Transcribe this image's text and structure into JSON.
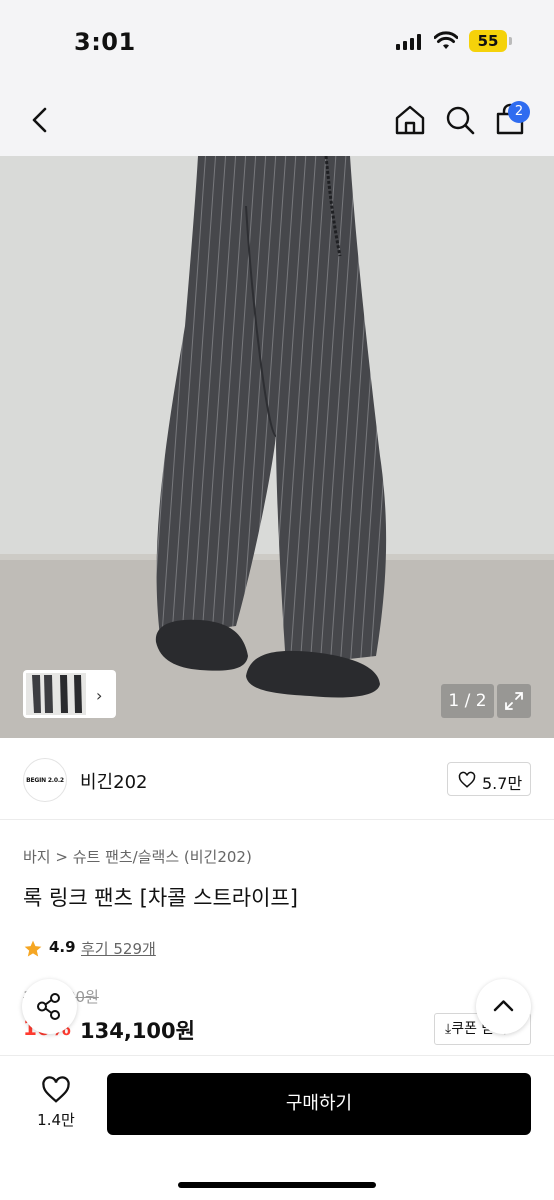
{
  "status_bar": {
    "time": "3:01",
    "battery": "55"
  },
  "nav": {
    "cart_count": "2"
  },
  "gallery": {
    "page_indicator": "1 / 2"
  },
  "brand": {
    "logo_text": "BEGIN 2.0.2",
    "name": "비긴202",
    "likes": "5.7만"
  },
  "product": {
    "breadcrumb": "바지 > 슈트 팬츠/슬랙스 (비긴202)",
    "title": "록 링크 팬츠 [차콜 스트라이프]",
    "rating": "4.9",
    "review_text": "후기 529개",
    "original_price": "149,000원",
    "discount": "10%",
    "price": "134,100원",
    "coupon_label": "쿠폰 받기"
  },
  "bottom_bar": {
    "wish_count": "1.4만",
    "buy_label": "구매하기"
  },
  "colors": {
    "accent_blue": "#2f6cf0",
    "discount_red": "#ff3b30",
    "star": "#f5a623",
    "buy_button": "#000000"
  }
}
